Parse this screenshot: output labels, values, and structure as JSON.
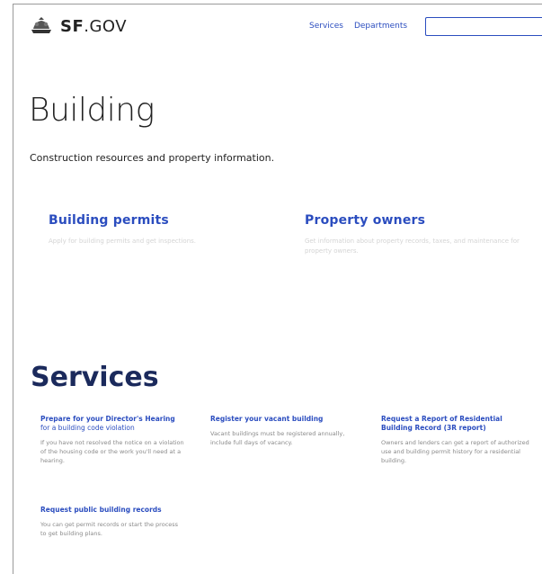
{
  "header": {
    "logo_bold": "SF",
    "logo_rest": ".GOV",
    "nav": [
      "Services",
      "Departments"
    ],
    "search_placeholder": "",
    "search_icon": "search-icon"
  },
  "hero": {
    "title": "Building",
    "subtitle": "Construction resources and property information."
  },
  "topics": [
    {
      "title": "Building permits",
      "desc": "Apply for building permits and get inspections."
    },
    {
      "title": "Property owners",
      "desc": "Get information about property records, taxes, and maintenance for property owners."
    }
  ],
  "services": {
    "title": "Services",
    "items": [
      {
        "title": "Prepare for your Director's Hearing",
        "title_rest": "for a building code violation",
        "desc": "If you have not resolved the notice on a violation of the housing code or the work you'll need at a hearing."
      },
      {
        "title": "Register your vacant building",
        "title_rest": "",
        "desc": "Vacant buildings must be registered annually, include full days of vacancy."
      },
      {
        "title": "Request a Report of Residential Building Record (3R report)",
        "title_rest": "",
        "desc": "Owners and lenders can get a report of authorized use and building permit history for a residential building."
      },
      {
        "title": "Request public building records",
        "title_rest": "",
        "desc": "You can get permit records or start the process to get building plans."
      }
    ]
  },
  "colors": {
    "link": "#2b4dbf",
    "heading_dark": "#1b2a5c"
  }
}
